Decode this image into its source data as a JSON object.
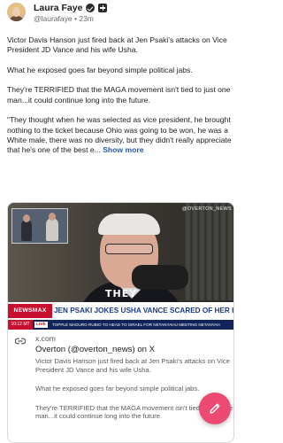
{
  "post": {
    "author": {
      "display_name": "Laura Faye",
      "handle": "@laurafaye",
      "separator": "•",
      "time_ago": "23m"
    },
    "body_paragraphs": [
      "Victor Davis Hanson just fired back at Jen Psaki's attacks on Vice President JD Vance and his wife Usha.",
      "What he exposed goes far beyond simple political jabs.",
      "They're TERRIFIED that the MAGA movement isn't tied to just one man...it could continue long into the future.",
      "“They thought when he was selected as vice president, he brought nothing to the ticket because Ohio was going to be won, he was a White male, there was no diversity, but they didn't really appreciate that he's one of the best e..."
    ],
    "show_more_label": "Show more"
  },
  "media": {
    "watermark": "@OVERTON_NEWS",
    "caption": "THEY",
    "network_logo": "NEWSMAX",
    "headline": "JEN PSAKI JOKES USHA VANCE SCARED OF HER HUSBAND",
    "ticker_time": "10:12 MT",
    "ticker_live": "LIVE",
    "ticker_text": "TOPPLE MADURO      RUBIO TO HEAD TO ISRAEL FOR NETANYAHU MEETING      NETANYAH"
  },
  "link_card": {
    "icon": "link-icon",
    "domain": "x.com",
    "title": "Overton (@overton_news) on X",
    "description_paragraphs": [
      "Victor Davis Hanson just fired back at Jen Psaki's attacks on Vice President JD Vance and his wife Usha.",
      "What he exposed goes far beyond simple political jabs.",
      "They're TERRIFIED that the MAGA movement isn't tied to just one man...it could continue long into the future."
    ]
  },
  "fab": {
    "icon": "pencil-icon",
    "color": "#ec4a72"
  },
  "colors": {
    "link": "#2458a8",
    "network_red": "#c8102e",
    "headline_blue": "#1a3b8c"
  }
}
